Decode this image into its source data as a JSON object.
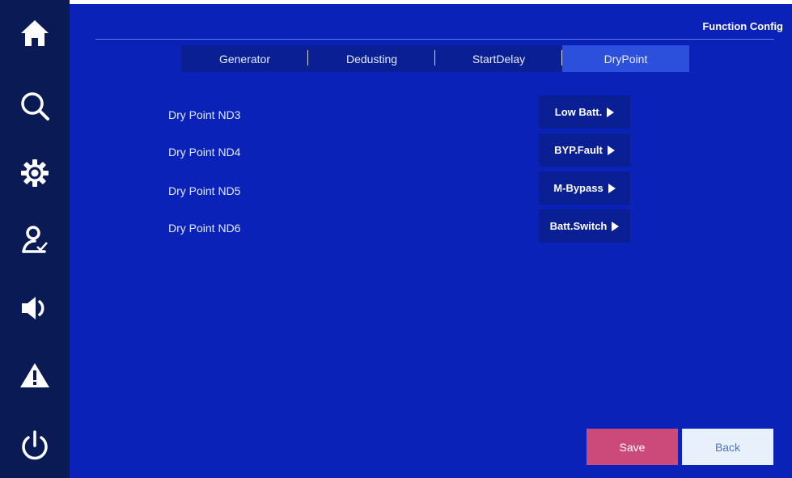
{
  "page": {
    "title": "Function Config"
  },
  "sidebar": {
    "items": [
      {
        "name": "home",
        "icon": "home-icon"
      },
      {
        "name": "search",
        "icon": "search-icon"
      },
      {
        "name": "settings",
        "icon": "gear-icon"
      },
      {
        "name": "user",
        "icon": "user-check-icon"
      },
      {
        "name": "sound",
        "icon": "speaker-icon"
      },
      {
        "name": "alarm",
        "icon": "warning-icon"
      },
      {
        "name": "power",
        "icon": "power-icon"
      }
    ]
  },
  "tabs": [
    {
      "label": "Generator",
      "active": false
    },
    {
      "label": "Dedusting",
      "active": false
    },
    {
      "label": "StartDelay",
      "active": false
    },
    {
      "label": "DryPoint",
      "active": true
    }
  ],
  "rows": [
    {
      "label": "Dry Point ND3",
      "value": "Low Batt."
    },
    {
      "label": "Dry Point ND4",
      "value": "BYP.Fault"
    },
    {
      "label": "Dry Point ND5",
      "value": "M-Bypass"
    },
    {
      "label": "Dry Point ND6",
      "value": "Batt.Switch"
    }
  ],
  "buttons": {
    "save": "Save",
    "back": "Back"
  },
  "colors": {
    "sidebar_bg": "#0a1a55",
    "main_bg": "#0a22b8",
    "tab_bg": "#0b1f94",
    "tab_active_bg": "#2d50dc",
    "save_bg": "#cc4a7a",
    "back_bg": "#e8f0fb"
  }
}
